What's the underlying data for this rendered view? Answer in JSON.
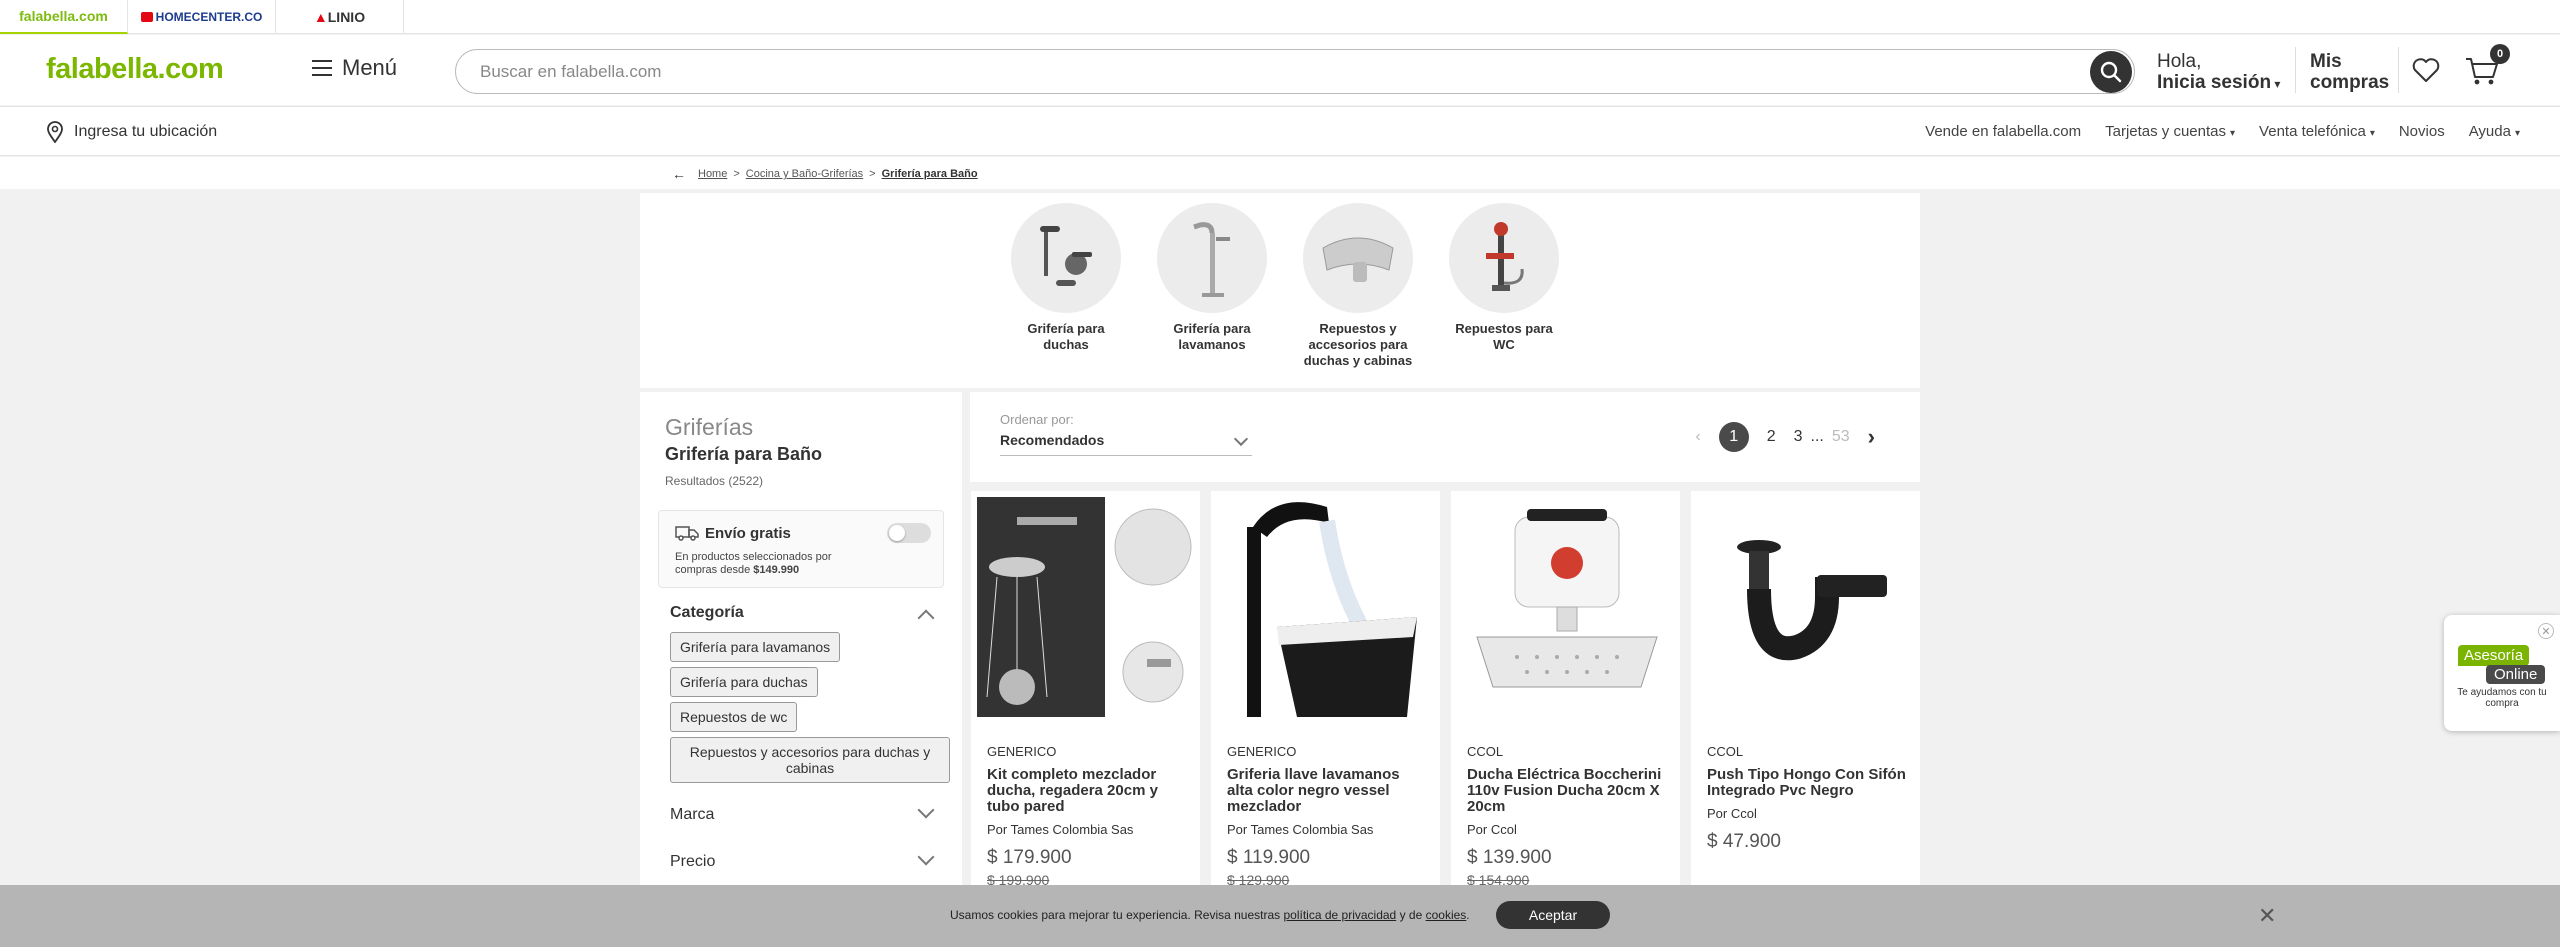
{
  "brand_tabs": [
    "falabella.com",
    "HOMECENTER.CO",
    "LINIO"
  ],
  "header": {
    "logo": "falabella.com",
    "menu_label": "Menú",
    "search_placeholder": "Buscar en falabella.com",
    "greeting_line1": "Hola,",
    "greeting_line2": "Inicia sesión",
    "orders_line1": "Mis",
    "orders_line2": "compras",
    "cart_count": "0"
  },
  "subnav": {
    "location": "Ingresa tu ubicación",
    "links": [
      "Vende en falabella.com",
      "Tarjetas y cuentas",
      "Venta telefónica",
      "Novios",
      "Ayuda"
    ]
  },
  "breadcrumb": {
    "items": [
      "Home",
      "Cocina y Baño-Griferías",
      "Grifería para Baño"
    ]
  },
  "categories": [
    {
      "line1": "Grifería para",
      "line2": "duchas",
      "line3": ""
    },
    {
      "line1": "Grifería para",
      "line2": "lavamanos",
      "line3": ""
    },
    {
      "line1": "Repuestos y",
      "line2": "accesorios para",
      "line3": "duchas y cabinas"
    },
    {
      "line1": "Repuestos para",
      "line2": "WC",
      "line3": ""
    }
  ],
  "filters": {
    "title": "Griferías",
    "subtitle": "Grifería para Baño",
    "results": "Resultados (2522)",
    "envio_title": "Envío gratis",
    "envio_desc_1": "En productos seleccionados por",
    "envio_desc_2": "compras desde",
    "envio_amount": "$149.990",
    "category_heading": "Categoría",
    "chips": [
      "Grifería para lavamanos",
      "Grifería para duchas",
      "Repuestos de wc",
      "Repuestos y accesorios para duchas y cabinas"
    ],
    "marca": "Marca",
    "precio": "Precio"
  },
  "results_bar": {
    "order_label": "Ordenar por:",
    "order_value": "Recomendados",
    "pages": [
      "1",
      "2",
      "3",
      "...",
      "53"
    ]
  },
  "products": [
    {
      "brand": "GENERICO",
      "name": "Kit completo mezclador ducha, regadera 20cm y tubo pared",
      "seller": "Por Tames Colombia Sas",
      "price": "$ 179.900",
      "old_price": "$ 199.900"
    },
    {
      "brand": "GENERICO",
      "name": "Griferia llave lavamanos alta color negro vessel mezclador",
      "seller": "Por Tames Colombia Sas",
      "price": "$ 119.900",
      "old_price": "$ 129.900"
    },
    {
      "brand": "CCOL",
      "name": "Ducha Eléctrica Boccherini 110v Fusion Ducha 20cm X 20cm",
      "seller": "Por Ccol",
      "price": "$ 139.900",
      "old_price": "$ 154.900"
    },
    {
      "brand": "CCOL",
      "name": "Push Tipo Hongo Con Sifón Integrado Pvc Negro",
      "seller": "Por Ccol",
      "price": "$ 47.900",
      "old_price": ""
    }
  ],
  "asesoria": {
    "line1": "Asesoría",
    "line2": "Online",
    "sub": "Te ayudamos con tu compra"
  },
  "cookie": {
    "text_before": "Usamos cookies para mejorar tu experiencia. Revisa nuestras",
    "privacy_link": "política de privacidad",
    "and": "y de",
    "cookies_link": "cookies",
    "accept": "Aceptar"
  },
  "colors": {
    "brand_green": "#7cb700",
    "dark": "#333333",
    "panel_bg": "#f1f1f1"
  }
}
